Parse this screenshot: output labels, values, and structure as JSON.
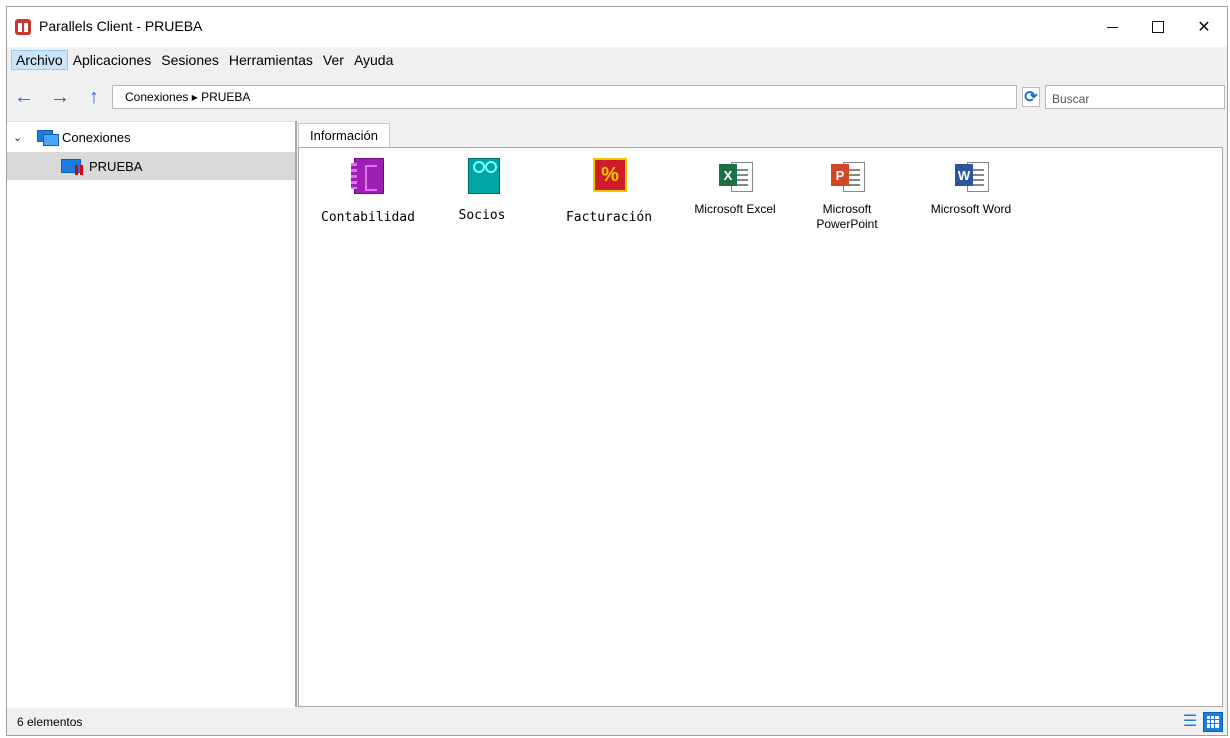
{
  "window": {
    "title": "Parallels Client - PRUEBA"
  },
  "menu": [
    "Archivo",
    "Aplicaciones",
    "Sesiones",
    "Herramientas",
    "Ver",
    "Ayuda"
  ],
  "toolbar": {
    "address": "Conexiones ▸ PRUEBA",
    "search_placeholder": "Buscar"
  },
  "tree": {
    "root_label": "Conexiones",
    "child_label": "PRUEBA"
  },
  "tabs": [
    "Información"
  ],
  "apps": [
    {
      "name": "Contabilidad",
      "icon": "contabilidad-icon"
    },
    {
      "name": "Socios",
      "icon": "socios-icon"
    },
    {
      "name": "Facturación",
      "icon": "facturacion-icon"
    },
    {
      "name": "Microsoft Excel",
      "icon": "excel-icon"
    },
    {
      "name": "Microsoft PowerPoint",
      "icon": "powerpoint-icon"
    },
    {
      "name": "Microsoft Word",
      "icon": "word-icon"
    }
  ],
  "status": {
    "count": "6 elementos"
  },
  "colors": {
    "accent": "#1e7be0",
    "selected_row": "#d9d9d9"
  }
}
